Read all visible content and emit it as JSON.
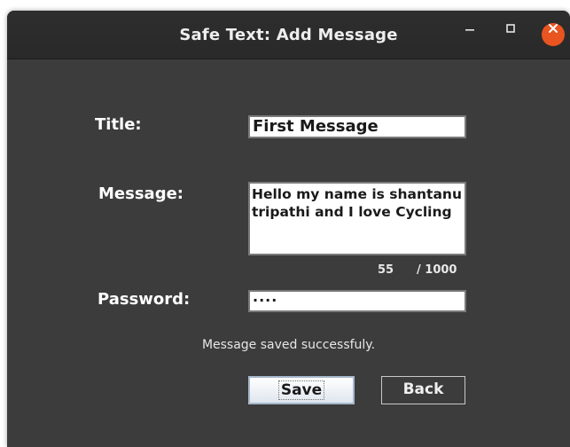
{
  "window": {
    "title": "Safe Text: Add Message",
    "minimize_icon": "minimize-icon",
    "maximize_icon": "maximize-icon",
    "close_icon": "close-icon",
    "close_color": "#e95420",
    "background_color": "#3c3c3c"
  },
  "form": {
    "title_label": "Title:",
    "title_value": "First Message",
    "message_label": "Message:",
    "message_value": "Hello my name is shantanu tripathi and I love Cycling",
    "char_count": "55",
    "char_limit": "/ 1000",
    "password_label": "Password:",
    "password_masked": "····"
  },
  "status": {
    "text": "Message saved successfuly."
  },
  "buttons": {
    "save_label": "Save",
    "back_label": "Back"
  }
}
